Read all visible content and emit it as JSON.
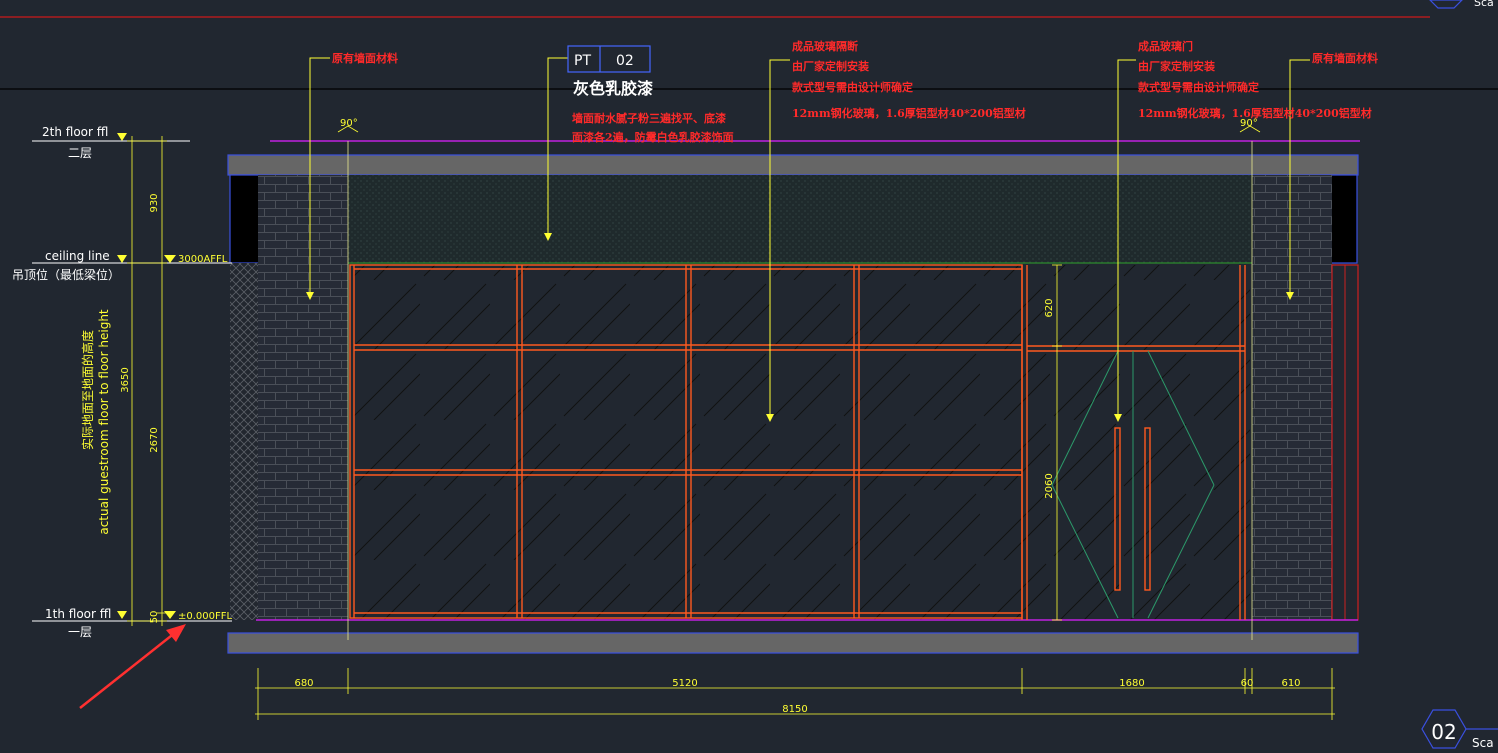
{
  "levels": {
    "floor2_label": "2th floor ffl",
    "floor2_cn": "二层",
    "ceiling_label": "ceiling line",
    "ceiling_cn": "吊顶位（最低梁位）",
    "ceiling_tag": "3000AFFL",
    "floor1_label": "1th floor ffl",
    "floor1_cn": "一层",
    "floor1_tag": "±0.000FFL"
  },
  "height_note": {
    "cn": "实际地面至地面的高度",
    "en": "actual guestroom floor to floor height"
  },
  "vertical_dims": {
    "d930": "930",
    "d3650": "3650",
    "d2670": "2670",
    "d50": "50",
    "d620": "620",
    "d2060": "2060"
  },
  "horizontal_dims": {
    "d680": "680",
    "d5120": "5120",
    "d1680": "1680",
    "d60": "60",
    "d610": "610",
    "d8150": "8150"
  },
  "angles": {
    "left": "90°",
    "right": "90°"
  },
  "tag": {
    "code": "PT",
    "num": "02",
    "title": "灰色乳胶漆",
    "line1": "墙面耐水腻子粉三遍找平、底漆",
    "line2": "面漆各2遍，防霉白色乳胶漆饰面"
  },
  "notes": {
    "left_wall": "原有墙面材料",
    "right_wall": "原有墙面材料",
    "partition": [
      "成品玻璃隔断",
      "由厂家定制安装",
      "款式型号需由设计师确定",
      "12mm钢化玻璃，1.6厚铝型材40*200铝型材"
    ],
    "door": [
      "成品玻璃门",
      "由厂家定制安装",
      "款式型号需由设计师确定",
      "12mm钢化玻璃，1.6厚铝型材40*200铝型材"
    ]
  },
  "corner": {
    "num": "02",
    "scale": "Sca"
  },
  "colors": {
    "bg": "#212730",
    "yellow": "#ffff33",
    "red": "#ff2a2a",
    "orange": "#ff5a1f",
    "magenta": "#c020e0"
  }
}
